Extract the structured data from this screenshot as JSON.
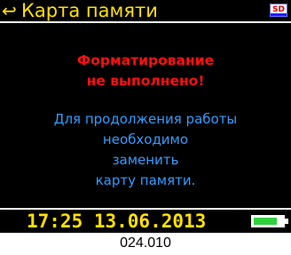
{
  "header": {
    "back_icon": "back-arrow-icon",
    "title": "Карта памяти",
    "sd_icon": "sd-card-icon",
    "sd_label": "SD"
  },
  "message": {
    "title_line1": "Форматирование",
    "title_line2": "не выполнено!",
    "body_line1": "Для продолжения работы",
    "body_line2": "необходимо",
    "body_line3": "заменить",
    "body_line4": "карту памяти."
  },
  "status": {
    "datetime": "17:25 13.06.2013",
    "battery_icon": "battery-icon",
    "battery_level": 0.8
  },
  "caption": "024.010",
  "colors": {
    "title": "#ffe000",
    "error": "#ff1010",
    "info": "#2f9dff",
    "battery": "#30d040"
  }
}
